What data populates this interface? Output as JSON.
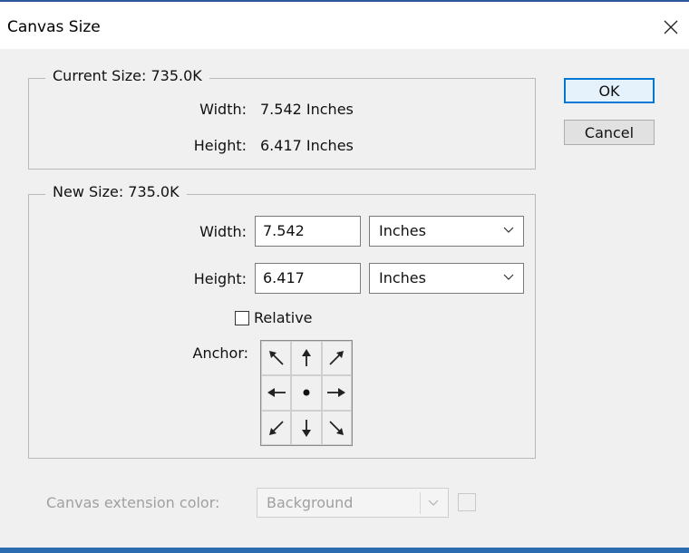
{
  "window": {
    "title": "Canvas Size"
  },
  "current_size": {
    "legend": "Current Size: 735.0K",
    "width_label": "Width:",
    "width_value": "7.542 Inches",
    "height_label": "Height:",
    "height_value": "6.417 Inches"
  },
  "new_size": {
    "legend": "New Size: 735.0K",
    "width_label": "Width:",
    "width_value": "7.542",
    "width_unit": "Inches",
    "height_label": "Height:",
    "height_value": "6.417",
    "height_unit": "Inches",
    "relative_label": "Relative",
    "relative_checked": false,
    "anchor_label": "Anchor:",
    "anchor_cells": [
      "arrow-nw-icon",
      "arrow-n-icon",
      "arrow-ne-icon",
      "arrow-w-icon",
      "center-dot-icon",
      "arrow-e-icon",
      "arrow-sw-icon",
      "arrow-s-icon",
      "arrow-se-icon"
    ]
  },
  "buttons": {
    "ok": "OK",
    "cancel": "Cancel"
  },
  "extension": {
    "label": "Canvas extension color:",
    "value": "Background"
  },
  "colors": {
    "accent": "#0078d7",
    "frame": "#2b579a",
    "background": "#f0f0f0"
  }
}
